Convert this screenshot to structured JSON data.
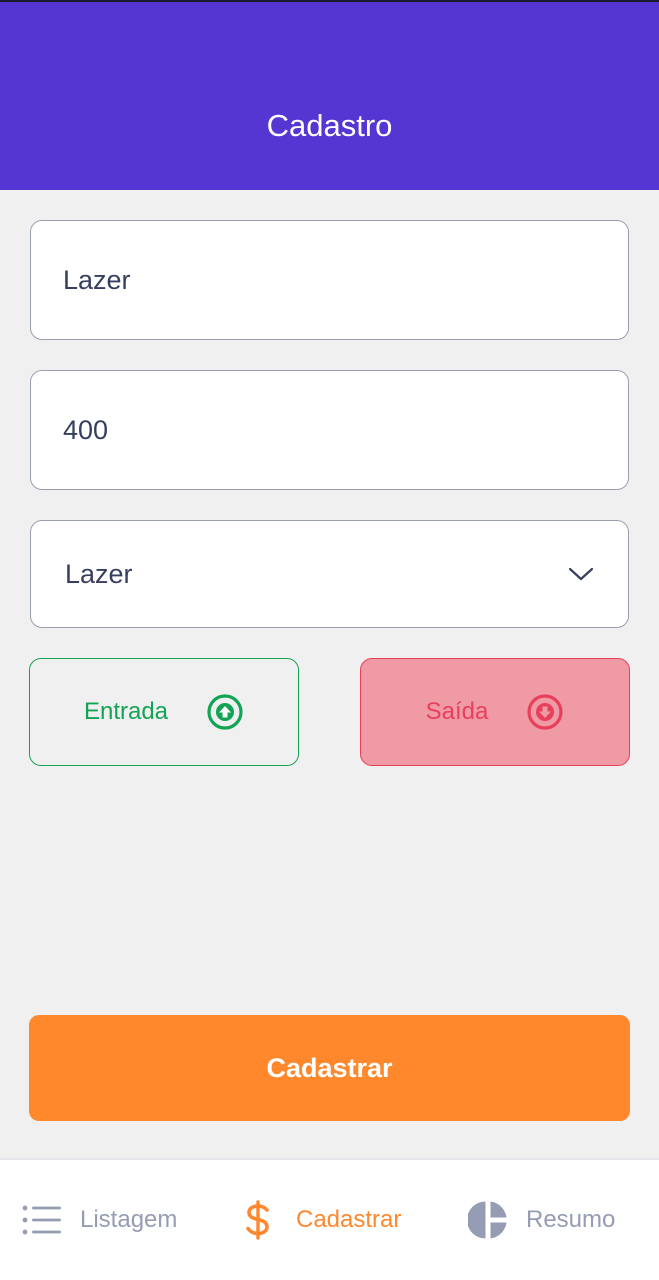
{
  "header": {
    "title": "Cadastro"
  },
  "form": {
    "name_value": "Lazer",
    "amount_value": "400",
    "category_selected": "Lazer",
    "income_label": "Entrada",
    "outcome_label": "Saída",
    "submit_label": "Cadastrar"
  },
  "tabs": [
    {
      "label": "Listagem",
      "icon": "list-icon",
      "active": false
    },
    {
      "label": "Cadastrar",
      "icon": "dollar-sign-icon",
      "active": true
    },
    {
      "label": "Resumo",
      "icon": "pie-chart-icon",
      "active": false
    }
  ],
  "colors": {
    "primary": "#5636d3",
    "background": "#f0f0f0",
    "text": "#363f5f",
    "success": "#12a454",
    "attention": "#e83f5b",
    "attention_light": "#f09aa6",
    "secondary": "#ff872c",
    "inactive": "#969cb3"
  }
}
